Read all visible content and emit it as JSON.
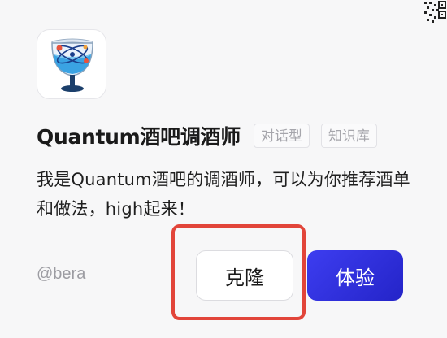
{
  "bot": {
    "name": "Quantum酒吧调酒师",
    "tags": [
      "对话型",
      "知识库"
    ],
    "description": "我是Quantum酒吧的调酒师，可以为你推荐酒单和做法，high起来！",
    "author": "@bera",
    "icon": "cocktail-glass-atom-icon"
  },
  "actions": {
    "clone_label": "克隆",
    "try_label": "体验"
  },
  "colors": {
    "accent": "#2f2fe0",
    "highlight": "#e2453a",
    "background": "#f7f7f8"
  }
}
